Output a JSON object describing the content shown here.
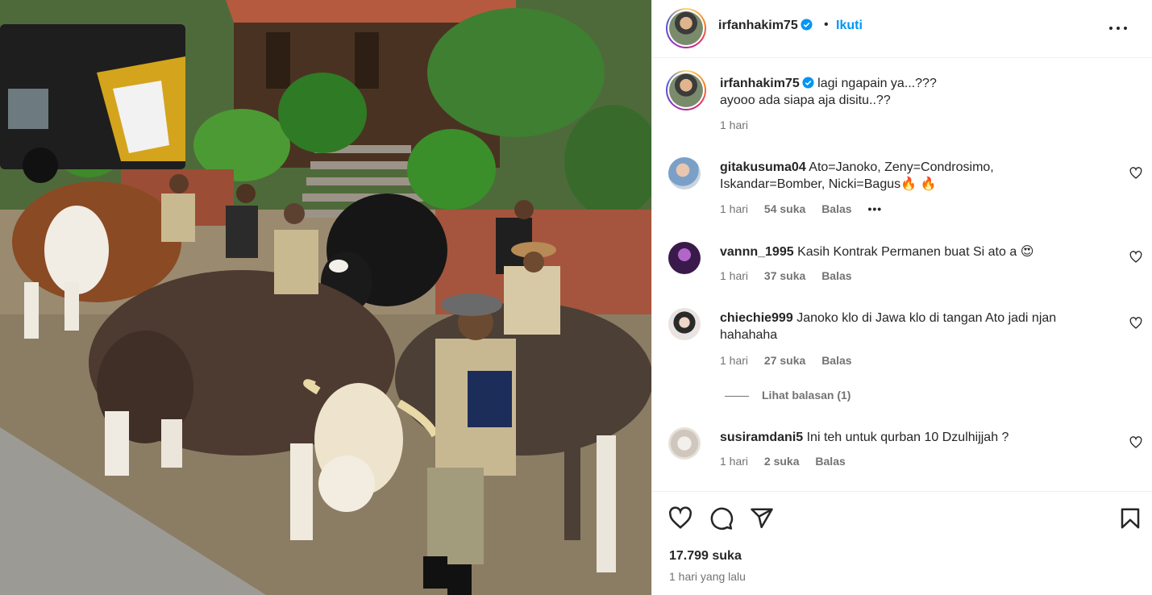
{
  "post": {
    "username": "irfanhakim75",
    "follow_label": "Ikuti",
    "more_icon": "more-options-icon",
    "caption_line1": "lagi ngapain ya...???",
    "caption_line2": "ayooo ada siapa aja disitu..??",
    "caption_time": "1 hari",
    "likes": "17.799 suka",
    "date": "1 hari yang lalu"
  },
  "comments": [
    {
      "username": "gitakusuma04",
      "text_line1": "Ato=Janoko, Zeny=Condrosimo,",
      "text_line2": "Iskandar=Bomber, Nicki=Bagus",
      "emoji": "🔥 🔥",
      "time": "1 hari",
      "likes": "54 suka",
      "reply": "Balas",
      "more": "•••"
    },
    {
      "username": "vannn_1995",
      "text_line1": "Kasih Kontrak Permanen buat Si ato a",
      "emoji": "😍",
      "time": "1 hari",
      "likes": "37 suka",
      "reply": "Balas"
    },
    {
      "username": "chiechie999",
      "text_line1": "Janoko klo di Jawa klo di tangan Ato jadi njan",
      "text_line2": "hahahaha",
      "time": "1 hari",
      "likes": "27 suka",
      "reply": "Balas",
      "view_replies": "Lihat balasan (1)"
    },
    {
      "username": "susiramdani5",
      "text_line1": "Ini teh untuk qurban 10 Dzulhijjah ?",
      "time": "1 hari",
      "likes": "2 suka",
      "reply": "Balas"
    }
  ],
  "colors": {
    "follow_blue": "#0095f6",
    "verified_blue": "#0095f6",
    "secondary_text": "#737373",
    "border": "#efefef"
  },
  "icons": [
    "heart-icon",
    "comment-icon",
    "share-icon",
    "bookmark-icon",
    "verified-badge-icon"
  ]
}
